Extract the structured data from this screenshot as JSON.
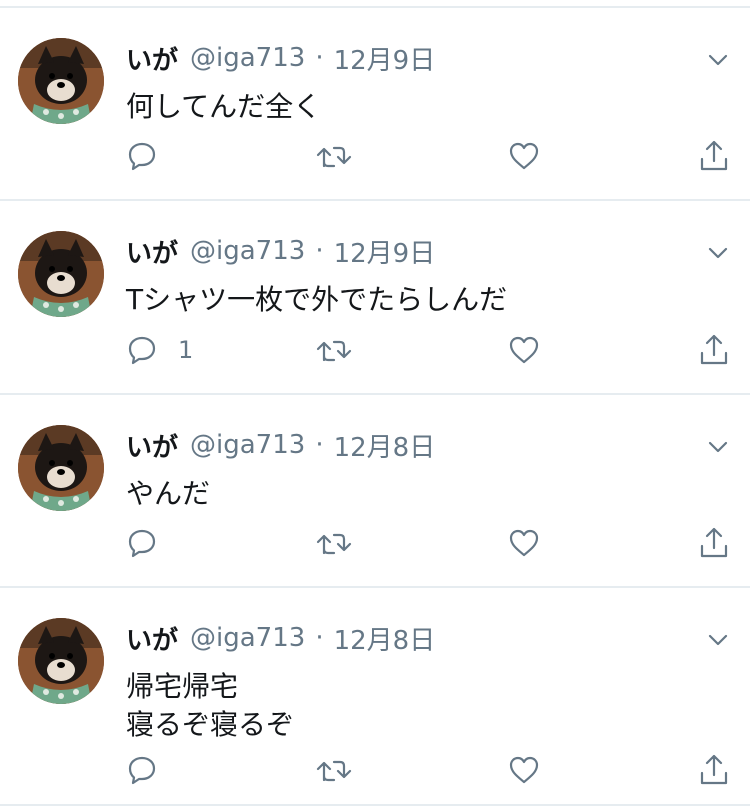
{
  "colors": {
    "text_primary": "#14171a",
    "text_secondary": "#657786",
    "divider": "#e6ecf0"
  },
  "tweets": [
    {
      "name": "いが",
      "handle": "@iga713",
      "separator": "·",
      "date": "12月9日",
      "text": "何してんだ全く",
      "reply_count": ""
    },
    {
      "name": "いが",
      "handle": "@iga713",
      "separator": "·",
      "date": "12月9日",
      "text": "Tシャツ一枚で外でたらしんだ",
      "reply_count": "1"
    },
    {
      "name": "いが",
      "handle": "@iga713",
      "separator": "·",
      "date": "12月8日",
      "text": "やんだ",
      "reply_count": ""
    },
    {
      "name": "いが",
      "handle": "@iga713",
      "separator": "·",
      "date": "12月8日",
      "text": "帰宅帰宅\n寝るぞ寝るぞ",
      "reply_count": ""
    }
  ],
  "icons": {
    "menu": "chevron-down-icon",
    "reply": "reply-icon",
    "retweet": "retweet-icon",
    "like": "heart-icon",
    "share": "share-icon"
  }
}
